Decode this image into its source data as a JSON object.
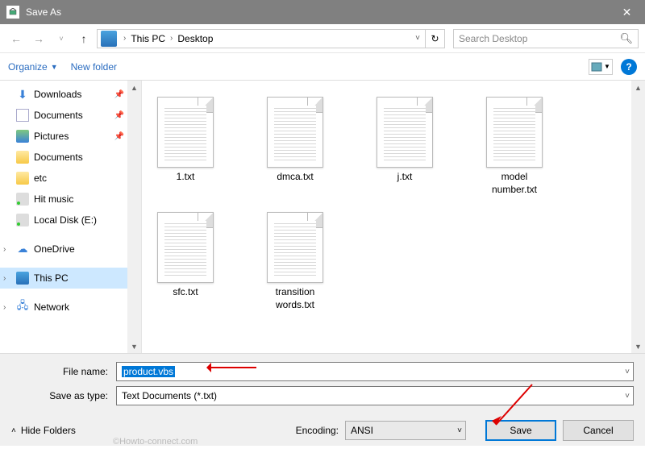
{
  "window": {
    "title": "Save As"
  },
  "breadcrumb": {
    "seg1": "This PC",
    "seg2": "Desktop"
  },
  "search": {
    "placeholder": "Search Desktop"
  },
  "toolbar": {
    "organize": "Organize",
    "newfolder": "New folder"
  },
  "sidebar": {
    "items": [
      {
        "label": "Downloads",
        "icon": "dl",
        "pinned": true
      },
      {
        "label": "Documents",
        "icon": "doc",
        "pinned": true
      },
      {
        "label": "Pictures",
        "icon": "pic",
        "pinned": true
      },
      {
        "label": "Documents",
        "icon": "folder"
      },
      {
        "label": "etc",
        "icon": "folder"
      },
      {
        "label": "Hit music",
        "icon": "disk"
      },
      {
        "label": "Local Disk (E:)",
        "icon": "disk"
      },
      {
        "label": "OneDrive",
        "icon": "cloud",
        "expandable": true,
        "spaced": true
      },
      {
        "label": "This PC",
        "icon": "pc",
        "expandable": true,
        "selected": true,
        "spaced": true
      },
      {
        "label": "Network",
        "icon": "net",
        "expandable": true,
        "spaced": true
      }
    ]
  },
  "files": [
    {
      "name": "1.txt"
    },
    {
      "name": "dmca.txt"
    },
    {
      "name": "j.txt"
    },
    {
      "name": "model number.txt"
    },
    {
      "name": "sfc.txt"
    },
    {
      "name": "transition words.txt"
    }
  ],
  "form": {
    "filename_label": "File name:",
    "filename_value": "product.vbs",
    "type_label": "Save as type:",
    "type_value": "Text Documents (*.txt)",
    "encoding_label": "Encoding:",
    "encoding_value": "ANSI",
    "hide_folders": "Hide Folders",
    "save": "Save",
    "cancel": "Cancel"
  },
  "watermark": "©Howto-connect.com"
}
